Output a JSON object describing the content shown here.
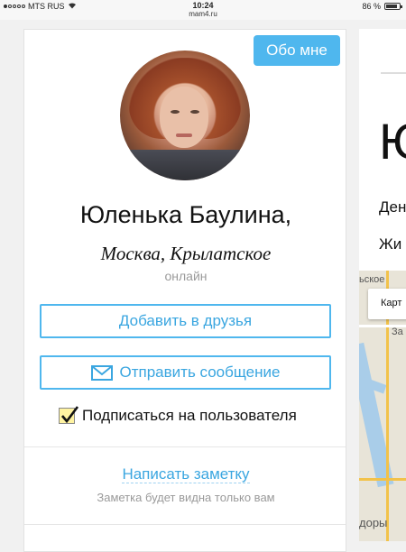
{
  "status_bar": {
    "carrier": "MTS RUS",
    "time": "10:24",
    "url": "mam4.ru",
    "battery": "86 %",
    "battery_level": 0.86
  },
  "profile": {
    "about_button": "Обо мне",
    "name": "Юленька Баулина,",
    "location": "Москва, Крылатское",
    "status": "онлайн",
    "add_friend_button": "Добавить в друзья",
    "send_message_button": "Отправить сообщение",
    "subscribe_label": "Подписаться на пользователя",
    "subscribe_checked": true,
    "write_note_link": "Написать заметку",
    "note_hint": "Заметка будет видна только вам"
  },
  "right_panel": {
    "heading_fragment": "Ю",
    "row1_fragment": "Ден",
    "row2_fragment": "Жи",
    "map_box_label": "Карт",
    "map_labels": [
      "ьское",
      "За",
      "доры"
    ]
  },
  "colors": {
    "accent": "#4fb7ee",
    "link": "#3aa6e0",
    "checkbox_fill": "#fff3a1"
  }
}
